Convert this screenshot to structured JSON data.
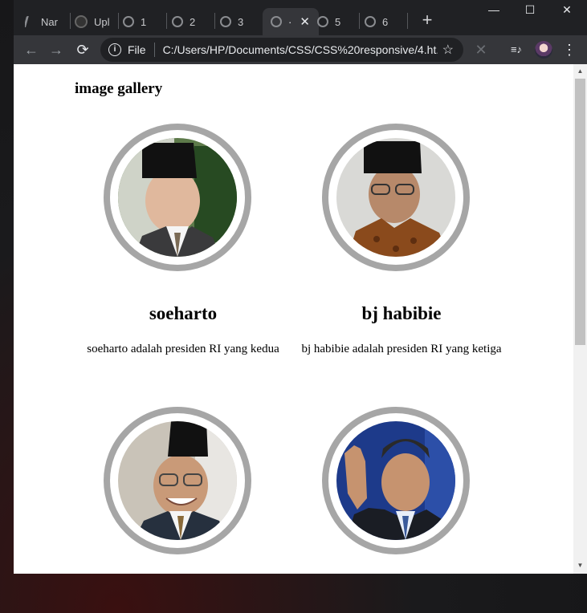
{
  "browser": {
    "tabs": [
      {
        "label": "Nar",
        "icon": "document-icon"
      },
      {
        "label": "Upl",
        "icon": "github-icon"
      },
      {
        "label": "1",
        "icon": "globe-icon"
      },
      {
        "label": "2",
        "icon": "globe-icon"
      },
      {
        "label": "3",
        "icon": "globe-icon"
      },
      {
        "label": "·",
        "icon": "globe-icon",
        "active": true
      },
      {
        "label": "5",
        "icon": "globe-icon"
      },
      {
        "label": "6",
        "icon": "globe-icon"
      }
    ],
    "new_tab": "+",
    "controls": {
      "minimize": "—",
      "maximize": "☐",
      "close": "✕"
    },
    "tab_close": "✕",
    "back": "←",
    "forward": "→",
    "reload": "⟳",
    "scheme": "File",
    "url": "C:/Users/HP/Documents/CSS/CSS%20responsive/4.ht...",
    "bookmark_star": "☆",
    "extension_x": "✕",
    "menu": "⋮",
    "media": "≡♪"
  },
  "page": {
    "heading": "image gallery",
    "cards": [
      {
        "name": "soeharto",
        "desc": "soeharto adalah presiden RI yang kedua"
      },
      {
        "name": "bj habibie",
        "desc": "bj habibie adalah presiden RI yang ketiga"
      },
      {
        "name": "",
        "desc": ""
      },
      {
        "name": "",
        "desc": ""
      }
    ]
  },
  "colors": {
    "frame_ring": "#a6a6a6",
    "tab_bg": "#202124",
    "toolbar_bg": "#35363a"
  }
}
